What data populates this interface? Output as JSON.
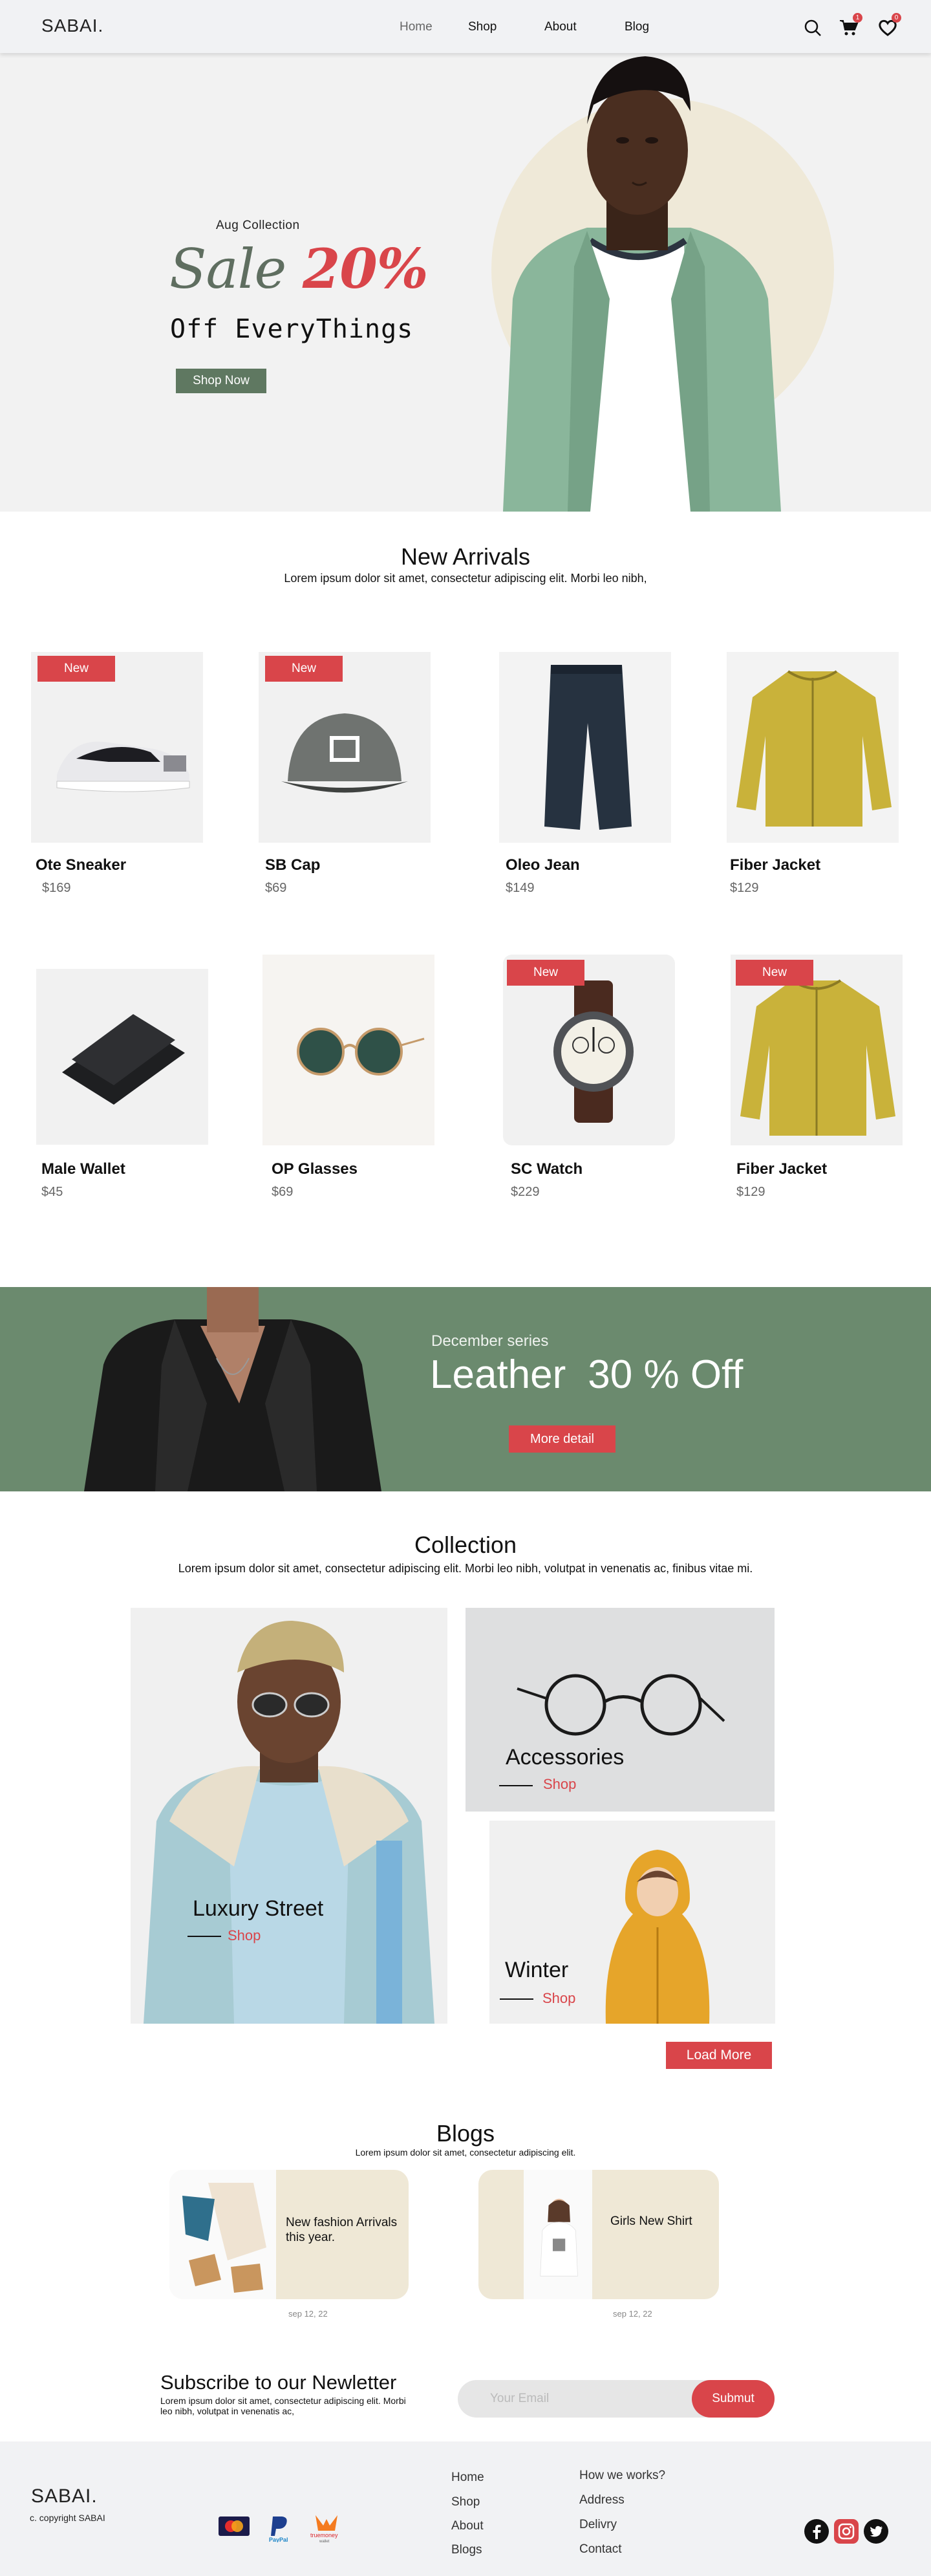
{
  "header": {
    "logo": "SABAI.",
    "nav": [
      "Home",
      "Shop",
      "About",
      "Blog"
    ],
    "cart_count": "1",
    "wishlist_count": "0"
  },
  "hero": {
    "kicker": "Aug Collection",
    "sale_word": "Sale",
    "sale_pct": "20%",
    "subtitle": "Off EveryThings",
    "button": "Shop Now"
  },
  "new_arrivals": {
    "title": "New Arrivals",
    "subtitle": "Lorem ipsum dolor sit amet, consectetur adipiscing elit. Morbi leo nibh,",
    "badge": "New",
    "products": [
      {
        "name": "Ote Sneaker",
        "price": "$169",
        "icon": "sneaker-image",
        "is_new": true
      },
      {
        "name": "SB Cap",
        "price": "$69",
        "icon": "cap-image",
        "is_new": true
      },
      {
        "name": "Oleo Jean",
        "price": "$149",
        "icon": "jeans-image",
        "is_new": false
      },
      {
        "name": "Fiber Jacket",
        "price": "$129",
        "icon": "jacket-image",
        "is_new": false
      },
      {
        "name": "Male Wallet",
        "price": "$45",
        "icon": "wallet-image",
        "is_new": false
      },
      {
        "name": "OP Glasses",
        "price": "$69",
        "icon": "glasses-image",
        "is_new": false
      },
      {
        "name": "SC Watch",
        "price": "$229",
        "icon": "watch-image",
        "is_new": true
      },
      {
        "name": "Fiber Jacket",
        "price": "$129",
        "icon": "jacket-image",
        "is_new": true
      }
    ]
  },
  "promo": {
    "kicker": "December series",
    "title_a": "Leather",
    "title_b": "30 % Off",
    "button": "More detail"
  },
  "collection": {
    "title": "Collection",
    "subtitle": "Lorem ipsum dolor sit amet, consectetur adipiscing elit. Morbi leo nibh, volutpat in venenatis ac, finibus vitae mi.",
    "items": [
      {
        "name": "Luxury Street",
        "link": "Shop"
      },
      {
        "name": "Accessories",
        "link": "Shop"
      },
      {
        "name": "Winter",
        "link": "Shop"
      }
    ],
    "load_more": "Load More"
  },
  "blogs": {
    "title": "Blogs",
    "subtitle": "Lorem ipsum dolor sit amet, consectetur adipiscing elit.",
    "posts": [
      {
        "title": "New fashion Arrivals this year.",
        "date": "sep 12, 22"
      },
      {
        "title": "Girls New Shirt",
        "date": "sep 12, 22"
      }
    ]
  },
  "subscribe": {
    "title": "Subscribe to our Newletter",
    "text": "Lorem ipsum dolor sit amet, consectetur adipiscing elit. Morbi leo nibh, volutpat in venenatis ac,",
    "placeholder": "Your Email",
    "button": "Submut"
  },
  "footer": {
    "logo": "SABAI.",
    "copyright": "c. copyright SABAI",
    "links_col1": [
      "Home",
      "Shop",
      "About",
      "Blogs"
    ],
    "links_col2": [
      "How we works?",
      "Address",
      "Delivry",
      "Contact"
    ],
    "payments": [
      "Mastercard",
      "PayPal",
      "truemoney"
    ],
    "payment_labels": {
      "paypal": "PayPal",
      "truemoney": "truemoney",
      "wallet": "wallet"
    },
    "social": [
      "facebook-icon",
      "instagram-icon",
      "twitter-icon"
    ],
    "colors": {
      "accent": "#d9454a",
      "green": "#6b8a6e"
    }
  }
}
